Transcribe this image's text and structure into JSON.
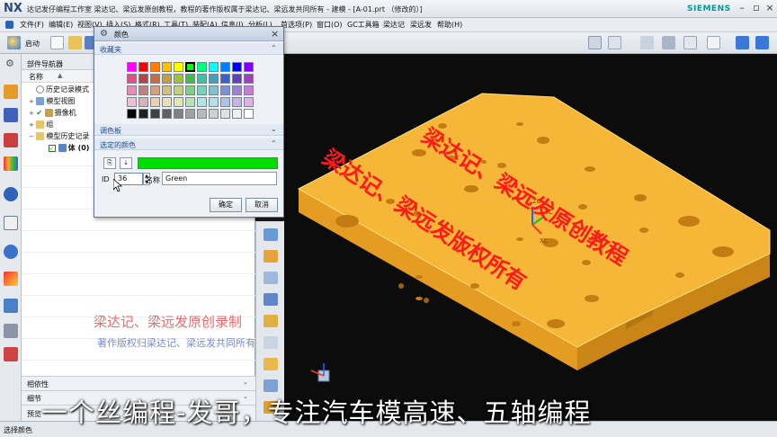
{
  "window": {
    "logo": "NX",
    "title": "达记发仔编程工作室 梁达记、梁远发原创教程，教程的著作版权属于梁达记、梁远发共同所有 - 建模 - [A-01.prt （修改的）]",
    "brand": "SIEMENS"
  },
  "menu": {
    "items": [
      "文件(F)",
      "编辑(E)",
      "视图(V)",
      "插入(S)",
      "格式(R)",
      "工具(T)",
      "装配(A)",
      "信息(I)",
      "分析(L)",
      "首选项(P)",
      "窗口(O)",
      "GC工具箱",
      "梁达记",
      "梁远发",
      "帮助(H)"
    ]
  },
  "toolbar": {
    "start_label": "启动"
  },
  "navigator": {
    "title": "部件导航器",
    "column_name": "名称",
    "tree": [
      {
        "label": "历史记录模式",
        "indent": 0
      },
      {
        "label": "模型视图",
        "indent": 0
      },
      {
        "label": "摄像机",
        "indent": 0
      },
      {
        "label": "组",
        "indent": 0
      },
      {
        "label": "模型历史记录",
        "indent": 0
      },
      {
        "label": "体 (0)",
        "indent": 1
      }
    ],
    "bottom_sections": [
      "相依性",
      "细节",
      "预览"
    ]
  },
  "dialog": {
    "title": "颜色",
    "sections": {
      "favorites": "收藏夹",
      "palette": "调色板",
      "selected": "选定的颜色"
    },
    "swatch_colors": [
      "#ff00ff",
      "#ff0000",
      "#ff8000",
      "#ffc000",
      "#ffff00",
      "#00ff00",
      "#00ff80",
      "#00ffff",
      "#0080ff",
      "#0000ff",
      "#8000ff",
      "#e05080",
      "#c04040",
      "#c07040",
      "#c0a040",
      "#a0c040",
      "#40c040",
      "#40c0a0",
      "#40a0c0",
      "#4060c0",
      "#6040c0",
      "#a040c0",
      "#e090b0",
      "#c08080",
      "#d0a080",
      "#d0c080",
      "#c0d080",
      "#80d080",
      "#80d0c0",
      "#80c0d0",
      "#8090d0",
      "#a080d0",
      "#c080d0",
      "#f0c0d0",
      "#e0b0b0",
      "#e8d0b0",
      "#e8e0b0",
      "#e0e8b0",
      "#b0e8b0",
      "#b0e8e0",
      "#b0e0e8",
      "#b0c0e8",
      "#c8b0e8",
      "#e0b0e8",
      "#000000",
      "#202020",
      "#404040",
      "#606060",
      "#808080",
      "#a0a0a0",
      "#b8b8b8",
      "#d0d0d0",
      "#e0e0e0",
      "#f0f0f0",
      "#ffffff"
    ],
    "selected_color": "#00dd00",
    "id_label": "ID",
    "id_value": "36",
    "name_label": "名称",
    "name_value": "Green",
    "ok_label": "确定",
    "cancel_label": "取消"
  },
  "axes": {
    "zc": "ZC",
    "yc": "YC",
    "xc": "XC"
  },
  "status": {
    "text": "选择颜色"
  },
  "watermarks": {
    "viewport_1": "梁达记、梁远发原创教程",
    "viewport_2": "梁达记、梁远发版权所有",
    "panel_1": "梁达记、梁远发原创录制",
    "panel_2": "著作版权归梁达记、梁远发共同所有",
    "caption": "一个丝编程-发哥，专注汽车模高速、五轴编程"
  },
  "colors": {
    "part": "#f5b531",
    "part_dark": "#c98a1a",
    "part_side": "#e09a22",
    "watermark": "#ff1a1a"
  }
}
